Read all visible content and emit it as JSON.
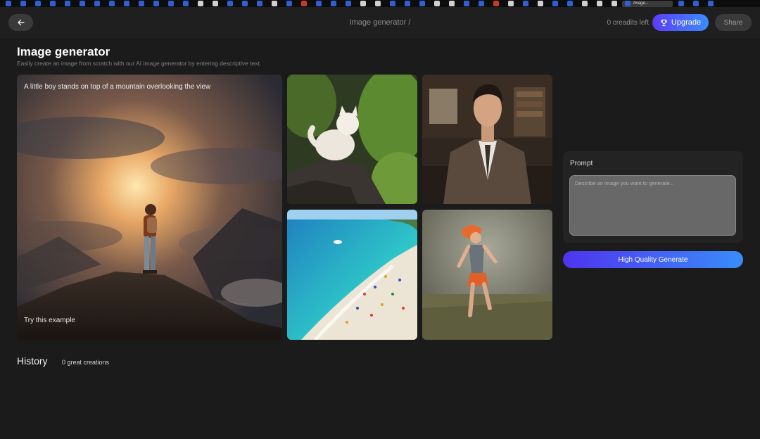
{
  "header": {
    "breadcrumb": "Image generator /",
    "credits": "0 creadits left",
    "upgrade_label": "Upgrade",
    "share_label": "Share",
    "active_tab_title": "Image..."
  },
  "page": {
    "title": "Image generator",
    "subtitle": "Easily create an image from scratch with our AI image generator by entering descriptive text."
  },
  "gallery": {
    "hero_caption": "A little boy stands on top of a mountain overlooking the view",
    "hero_action": "Try this example"
  },
  "prompt": {
    "label": "Prompt",
    "placeholder": "Describe an image you want to generate..."
  },
  "generate_label": "High Quality Generate",
  "history": {
    "title": "History",
    "count": "0 great creations"
  },
  "colors": {
    "background": "#1b1b1b",
    "accent_start": "#5b3df5",
    "accent_end": "#3a8cff"
  }
}
